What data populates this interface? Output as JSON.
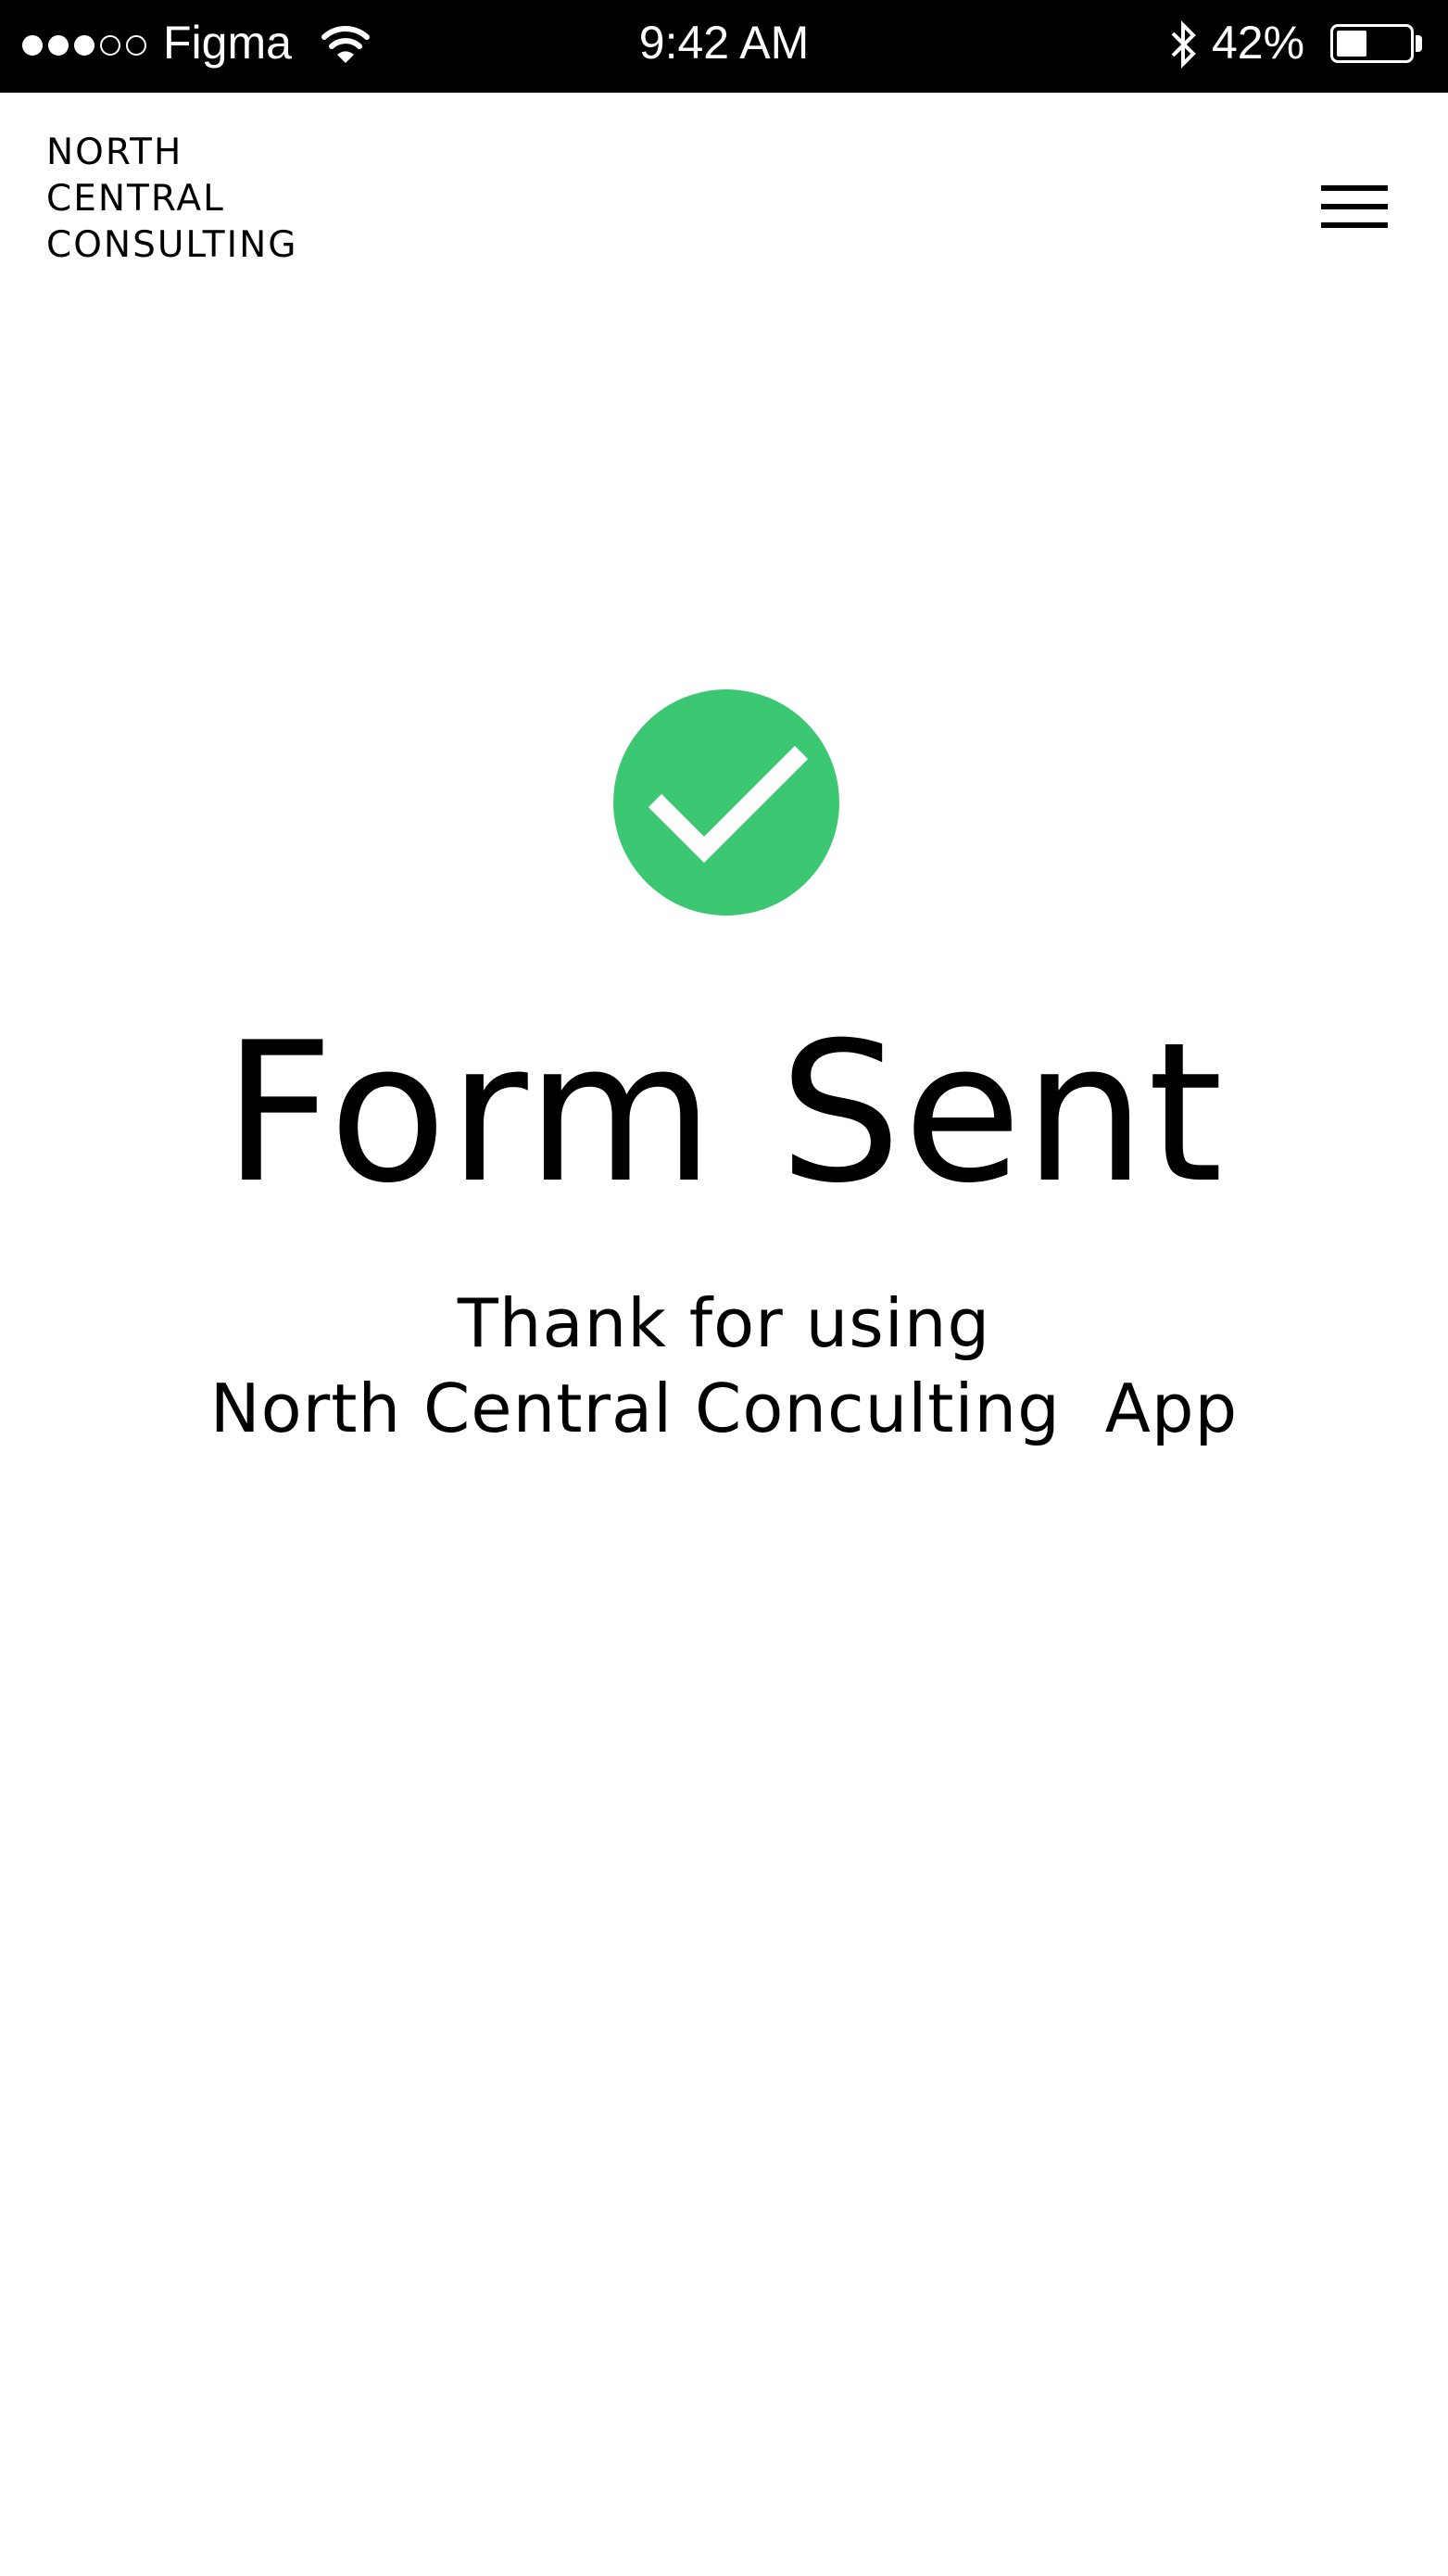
{
  "status_bar": {
    "signal_dots": [
      true,
      true,
      true,
      false,
      false
    ],
    "carrier": "Figma",
    "time": "9:42 AM",
    "battery_percent_label": "42%",
    "battery_level": 0.42,
    "icons": [
      "signal-dots-icon",
      "wifi-icon",
      "bluetooth-icon",
      "battery-icon"
    ]
  },
  "header": {
    "brand_lines": [
      "NORTH",
      "CENTRAL",
      "CONSULTING"
    ],
    "menu_icon": "hamburger-menu-icon"
  },
  "confirmation": {
    "icon": "checkmark-circle-icon",
    "icon_color": "#3CC872",
    "title": "Form Sent",
    "message_line_1": "Thank for using",
    "message_line_2": "North Central Conculting  App"
  }
}
